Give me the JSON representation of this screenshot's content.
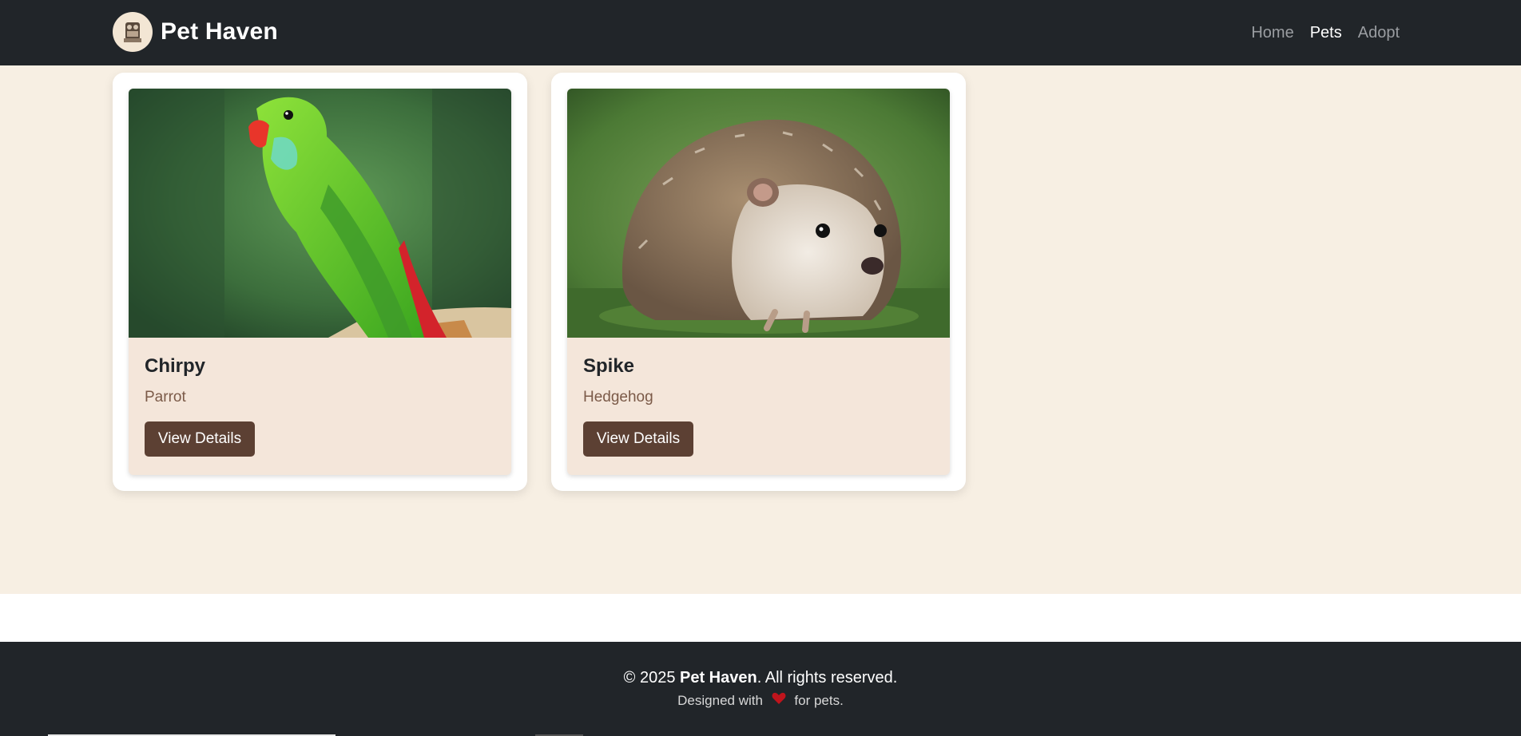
{
  "brand": {
    "name": "Pet Haven",
    "logo_icon": "pet-logo-icon"
  },
  "nav": {
    "links": [
      {
        "label": "Home",
        "active": false
      },
      {
        "label": "Pets",
        "active": true
      },
      {
        "label": "Adopt",
        "active": false
      }
    ]
  },
  "pets": [
    {
      "name": "Chirpy",
      "type": "Parrot",
      "button_label": "View Details",
      "image": "green-parrot-photo"
    },
    {
      "name": "Spike",
      "type": "Hedgehog",
      "button_label": "View Details",
      "image": "hedgehog-photo"
    }
  ],
  "footer": {
    "copyright_prefix": "© 2025 ",
    "brand": "Pet Haven",
    "copyright_suffix": ". All rights reserved.",
    "designed_prefix": "Designed with",
    "heart_icon": "heart-icon",
    "designed_suffix": "for pets."
  },
  "colors": {
    "navbar": "#212529",
    "page_background": "#f7efe3",
    "card_body": "#f4e6da",
    "button": "#5c4033",
    "pet_type_text": "#7b5a48",
    "heart": "#c0141c"
  }
}
